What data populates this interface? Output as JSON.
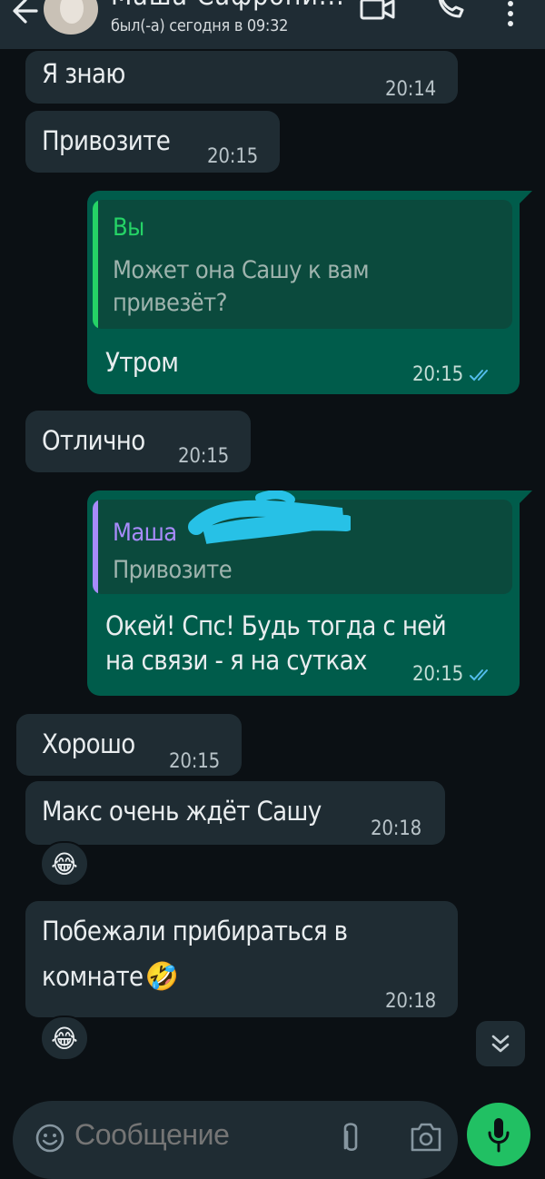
{
  "header": {
    "contact_name": "Маша Сафрони...",
    "status": "был(-а) сегодня в 09:32",
    "icons": {
      "back": "back-arrow-icon",
      "video": "video-call-icon",
      "call": "phone-call-icon",
      "menu": "more-vertical-icon"
    }
  },
  "messages": [
    {
      "id": "m1",
      "direction": "incoming",
      "text": "Я знаю",
      "time": "20:14"
    },
    {
      "id": "m2",
      "direction": "incoming",
      "text": "Привозите",
      "time": "20:15"
    },
    {
      "id": "m3",
      "direction": "outgoing",
      "quote": {
        "author": "Вы",
        "lines": [
          "Может она Сашу к вам",
          "привезёт?"
        ],
        "color": "#25d366"
      },
      "text": "Утром",
      "time": "20:15",
      "read": true
    },
    {
      "id": "m4",
      "direction": "incoming",
      "text": "Отлично",
      "time": "20:15"
    },
    {
      "id": "m5",
      "direction": "outgoing",
      "quote": {
        "author": "Маша",
        "lines": [
          "Привозите"
        ],
        "color": "#a78bfa"
      },
      "lines": [
        "Окей! Спс! Будь тогда с ней",
        "на связи - я на сутках"
      ],
      "time": "20:15",
      "read": true
    },
    {
      "id": "m6",
      "direction": "incoming",
      "text": "Хорошо",
      "time": "20:15"
    },
    {
      "id": "m7",
      "direction": "incoming",
      "text": "Макс очень ждёт Сашу",
      "time": "20:18",
      "reaction": "😂"
    },
    {
      "id": "m8",
      "direction": "incoming",
      "lines": [
        "Побежали прибираться в",
        "комнате"
      ],
      "inline_emoji": "🤣",
      "time": "20:18",
      "reaction": "😂"
    }
  ],
  "composer": {
    "placeholder": "Сообщение",
    "icons": {
      "emoji": "emoji-icon",
      "attach": "paperclip-icon",
      "camera": "camera-icon",
      "mic": "microphone-icon"
    }
  },
  "scroll_button": {
    "icon": "double-chevron-down-icon"
  },
  "colors": {
    "background": "#0b1014",
    "incoming_bubble": "#1f2c33",
    "outgoing_bubble": "#005c4b",
    "read_ticks": "#53bdeb",
    "accent": "#21c063",
    "censor_scribble": "#27c1e6"
  }
}
